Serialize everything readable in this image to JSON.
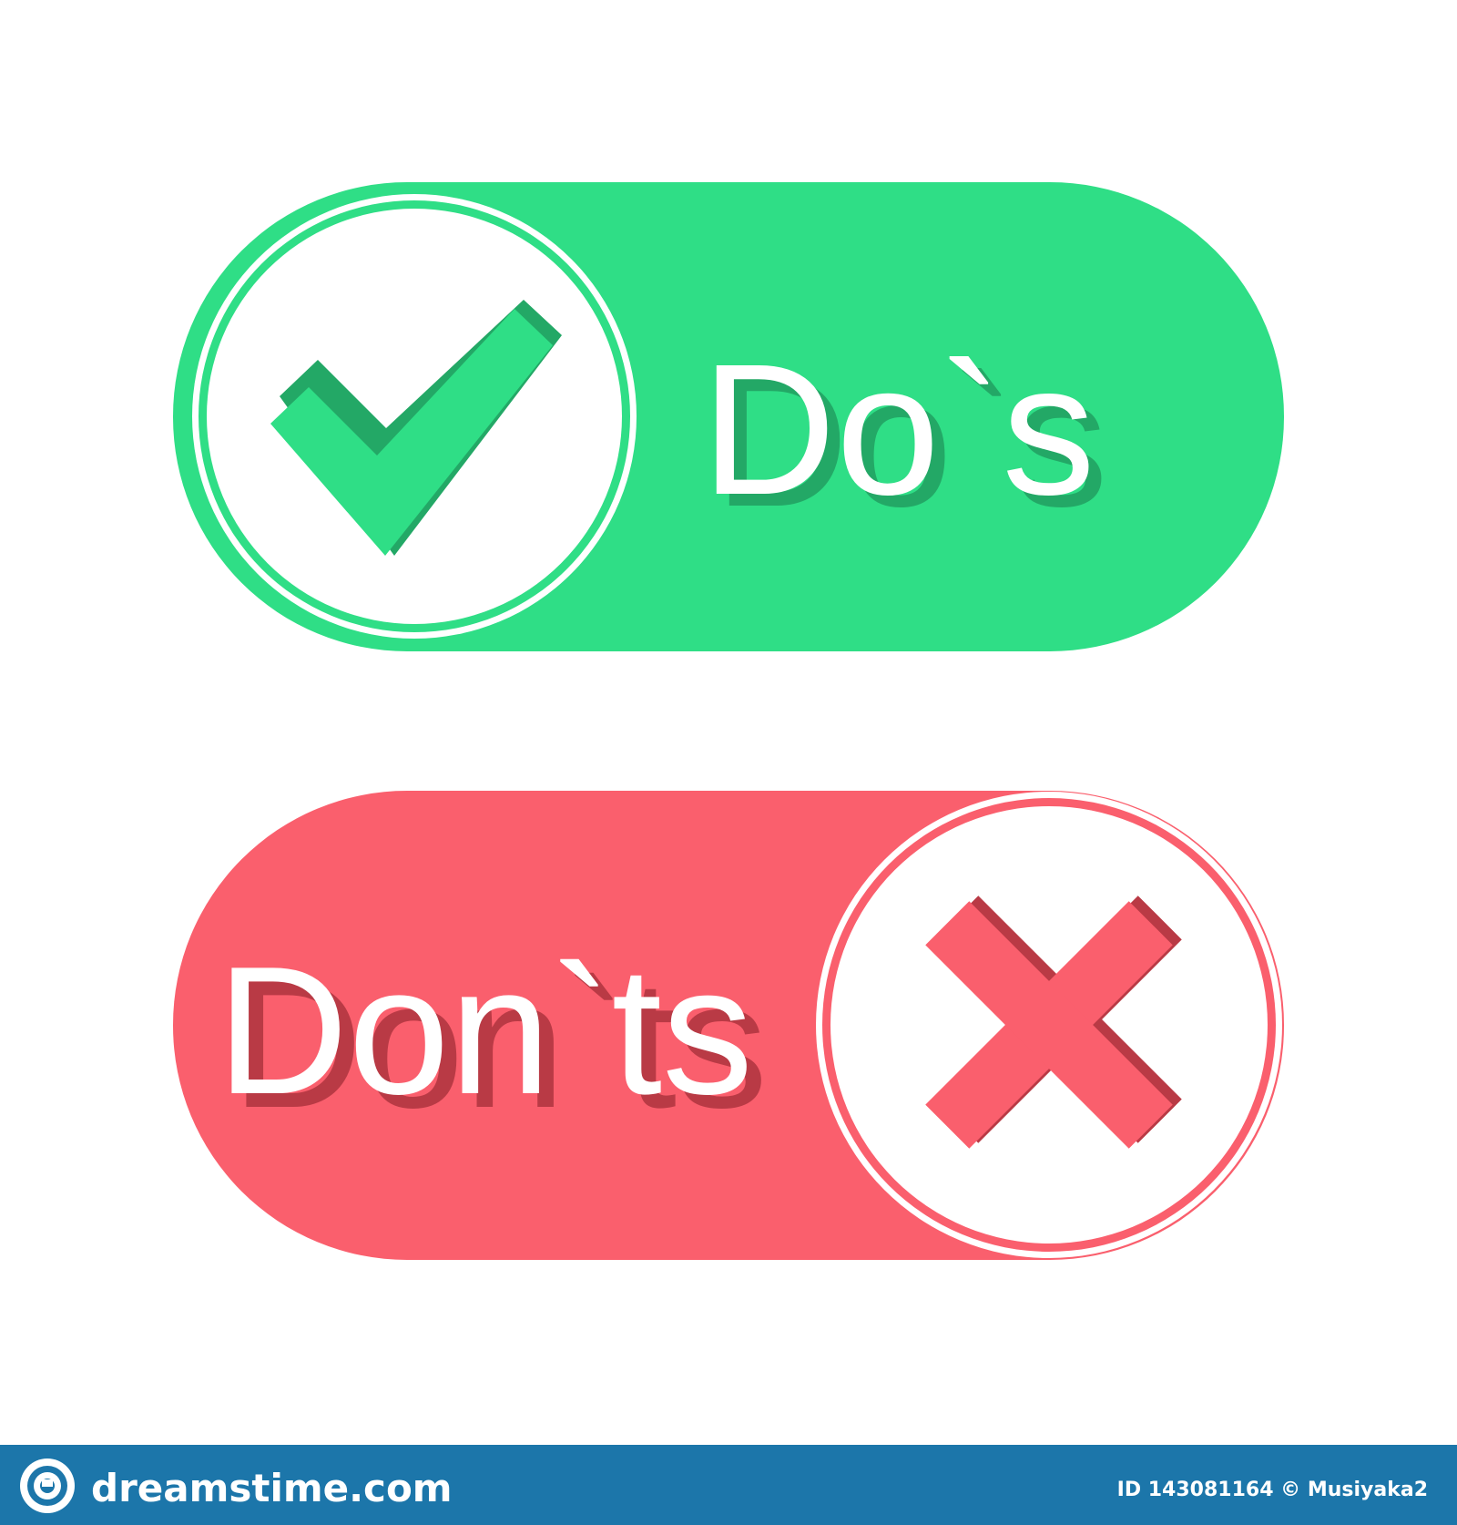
{
  "colors": {
    "background": "#ffffff",
    "dos_green": "#2fde86",
    "dos_green_dark": "#23a866",
    "donts_red": "#fa5f6d",
    "donts_red_dark": "#b93a45",
    "white": "#ffffff",
    "footer_bar": "#1c76aa"
  },
  "dos_badge": {
    "label": "Do`s",
    "icon": "check-mark-icon"
  },
  "donts_badge": {
    "label": "Don`ts",
    "icon": "cross-mark-icon"
  },
  "footer": {
    "logo_icon": "dreamstime-spiral-logo-icon",
    "brand": "dreamstime.com",
    "credit": "ID 143081164 © Musiyaka2"
  }
}
